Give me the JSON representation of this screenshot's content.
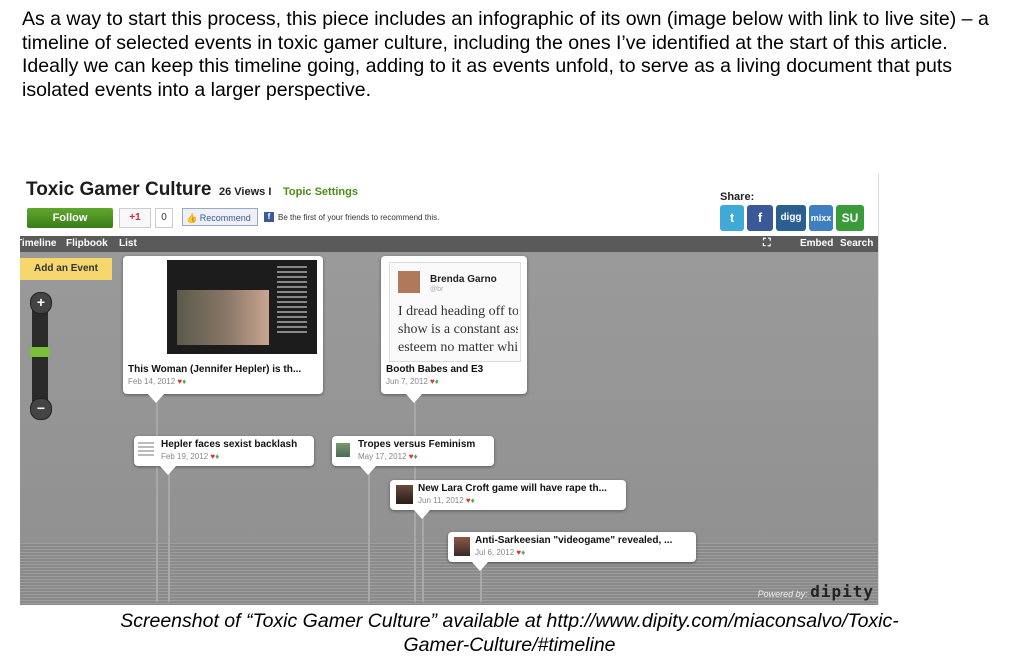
{
  "article": {
    "paragraph": "As a way to start this process, this piece includes an infographic of its own (image below with link to live site) – a timeline of selected events in toxic gamer culture, including the ones I’ve identified at the start of this article. Ideally we can keep this timeline going, adding to it as events unfold, to serve as a living document that puts isolated events into a larger perspective.",
    "caption_line1": "Screenshot of “Toxic Gamer Culture” available at http://www.dipity.com/miaconsalvo/Toxic-",
    "caption_line2": "Gamer-Culture/#timeline"
  },
  "screenshot": {
    "title": "Toxic Gamer Culture",
    "views": "26 Views I",
    "topic_settings": "Topic Settings",
    "follow_label": "Follow",
    "gplus_label": "+1",
    "gplus_count": "0",
    "recommend_label": "Recommend",
    "fb_text": "Be the first of your friends to recommend this.",
    "share_label": "Share:",
    "share_buttons": [
      "t",
      "f",
      "digg",
      "mixx",
      "SU"
    ],
    "nav": {
      "timeline": "Timeline",
      "flipbook": "Flipbook",
      "list": "List",
      "embed": "Embed",
      "search": "Search"
    },
    "add_event": "Add an Event",
    "zoom_in": "+",
    "zoom_out": "−",
    "events": [
      {
        "title": "This Woman (Jennifer Hepler) is th...",
        "date": "Feb 14, 2012"
      },
      {
        "title": "Booth Babes and E3",
        "date": "Jun 7, 2012",
        "tweet_user": "Brenda Garno",
        "tweet_handle": "@br",
        "tweet_lines": [
          "I dread heading off to",
          "show is a constant ass",
          "esteem no matter whi"
        ]
      },
      {
        "title": "Hepler faces sexist backlash",
        "date": "Feb 19, 2012"
      },
      {
        "title": "Tropes versus Feminism",
        "date": "May 17, 2012"
      },
      {
        "title": "New Lara Croft game will have rape th...",
        "date": "Jun 11, 2012"
      },
      {
        "title": "Anti-Sarkeesian \"videogame\" revealed, ...",
        "date": "Jul 6, 2012"
      }
    ],
    "powered_by": "Powered by:",
    "brand": "dipity"
  }
}
